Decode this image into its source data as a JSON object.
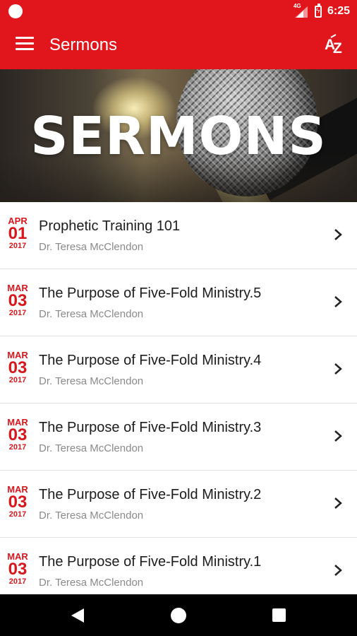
{
  "status_bar": {
    "network_label": "4G",
    "time": "6:25"
  },
  "app_bar": {
    "title": "Sermons",
    "menu_icon": "hamburger-menu-icon",
    "sort_icon": "sort-a-z-icon",
    "background_color": "#e0161c"
  },
  "hero": {
    "banner_text": "SERMONS"
  },
  "sermons": [
    {
      "month": "APR",
      "day": "01",
      "year": "2017",
      "title": "Prophetic Training 101",
      "speaker": "Dr. Teresa McClendon"
    },
    {
      "month": "MAR",
      "day": "03",
      "year": "2017",
      "title": "The Purpose of Five-Fold Ministry.5",
      "speaker": "Dr. Teresa McClendon"
    },
    {
      "month": "MAR",
      "day": "03",
      "year": "2017",
      "title": "The Purpose of Five-Fold Ministry.4",
      "speaker": "Dr. Teresa McClendon"
    },
    {
      "month": "MAR",
      "day": "03",
      "year": "2017",
      "title": "The Purpose of Five-Fold Ministry.3",
      "speaker": "Dr. Teresa McClendon"
    },
    {
      "month": "MAR",
      "day": "03",
      "year": "2017",
      "title": "The Purpose of Five-Fold Ministry.2",
      "speaker": "Dr. Teresa McClendon"
    },
    {
      "month": "MAR",
      "day": "03",
      "year": "2017",
      "title": "The Purpose of Five-Fold Ministry.1",
      "speaker": "Dr. Teresa McClendon"
    }
  ],
  "nav_bar": {
    "back_icon": "back-triangle-icon",
    "home_icon": "home-circle-icon",
    "recents_icon": "recents-square-icon"
  },
  "colors": {
    "accent": "#e0161c",
    "date_text": "#d8171d",
    "speaker_text": "#8a8a8a"
  }
}
